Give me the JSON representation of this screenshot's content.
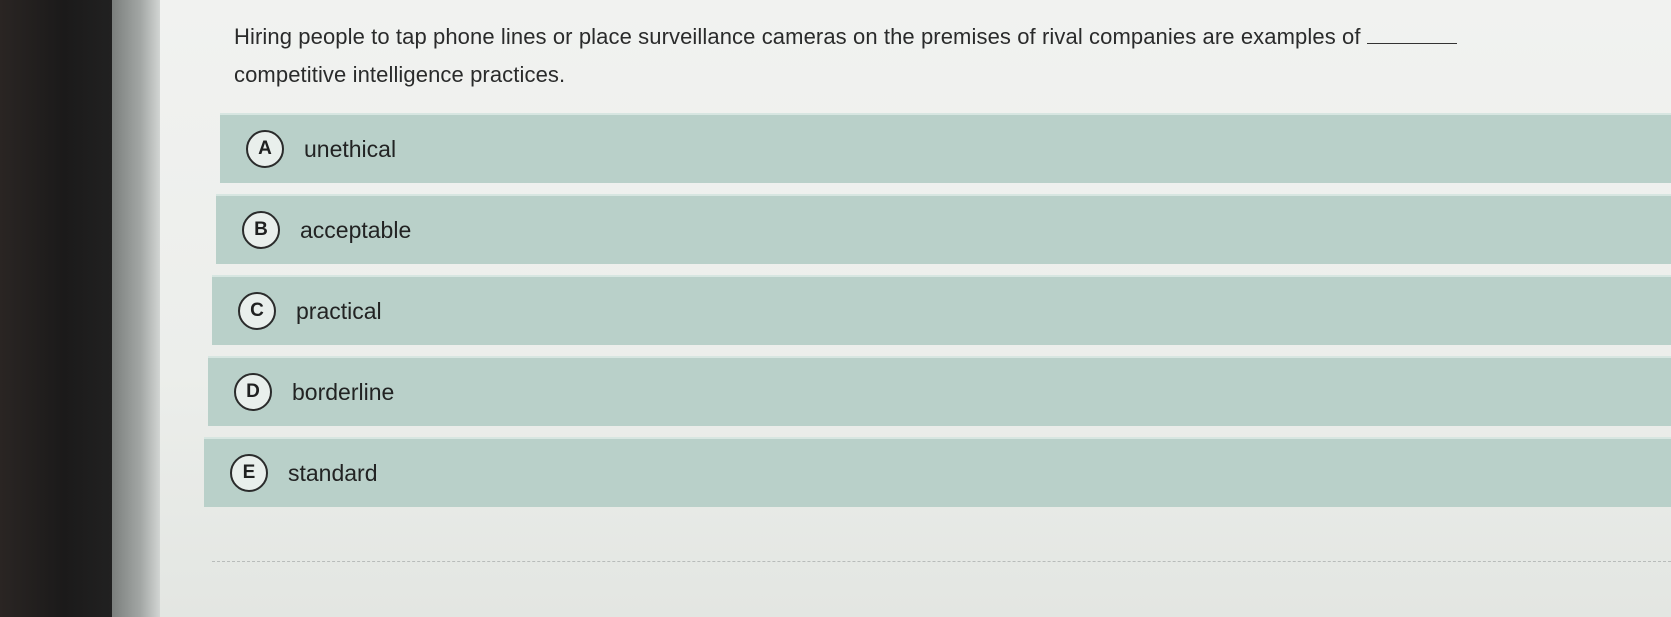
{
  "question": {
    "text": "Hiring people to tap phone lines or place surveillance cameras on the premises of rival companies are examples of",
    "continuation": "competitive intelligence practices."
  },
  "options": [
    {
      "letter": "A",
      "label": "unethical"
    },
    {
      "letter": "B",
      "label": "acceptable"
    },
    {
      "letter": "C",
      "label": "practical"
    },
    {
      "letter": "D",
      "label": "borderline"
    },
    {
      "letter": "E",
      "label": "standard"
    }
  ],
  "colors": {
    "option_background": "#b9d0c9",
    "page_background": "#eceeeb",
    "text": "#2a2b2b"
  }
}
